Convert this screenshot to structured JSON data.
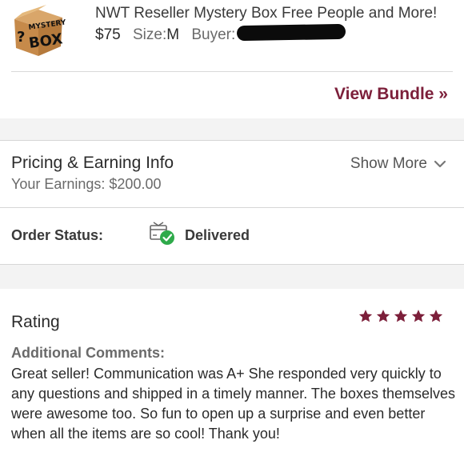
{
  "item": {
    "thumbnail_icon": "mystery-box-image",
    "thumbnail_text_top": "MYSTERY",
    "thumbnail_text_bottom": "BOX",
    "thumbnail_mark": "?",
    "title": "NWT Reseller Mystery Box Free People and More!",
    "price": "$75",
    "size_label": "Size:",
    "size_value": "M",
    "buyer_label": "Buyer:"
  },
  "bundle": {
    "view_label": "View Bundle »"
  },
  "pricing": {
    "title": "Pricing & Earning Info",
    "earnings": "Your Earnings: $200.00",
    "show_more": "Show More",
    "show_more_icon": "chevron-down-icon"
  },
  "order_status": {
    "label": "Order Status:",
    "icon": "delivered-box-check-icon",
    "value": "Delivered"
  },
  "rating": {
    "title": "Rating",
    "stars": 5,
    "max_stars": 5,
    "comments_label": "Additional Comments:",
    "comments": "Great seller! Communication was A+ She responded very quickly to any questions and shipped in a timely manner. The boxes themselves were awesome too. So fun to open up a surprise and even better when all the items are so cool! Thank you!"
  },
  "colors": {
    "accent": "#7c1f3a",
    "success": "#2eaa4a",
    "band": "#f3f3f3"
  }
}
